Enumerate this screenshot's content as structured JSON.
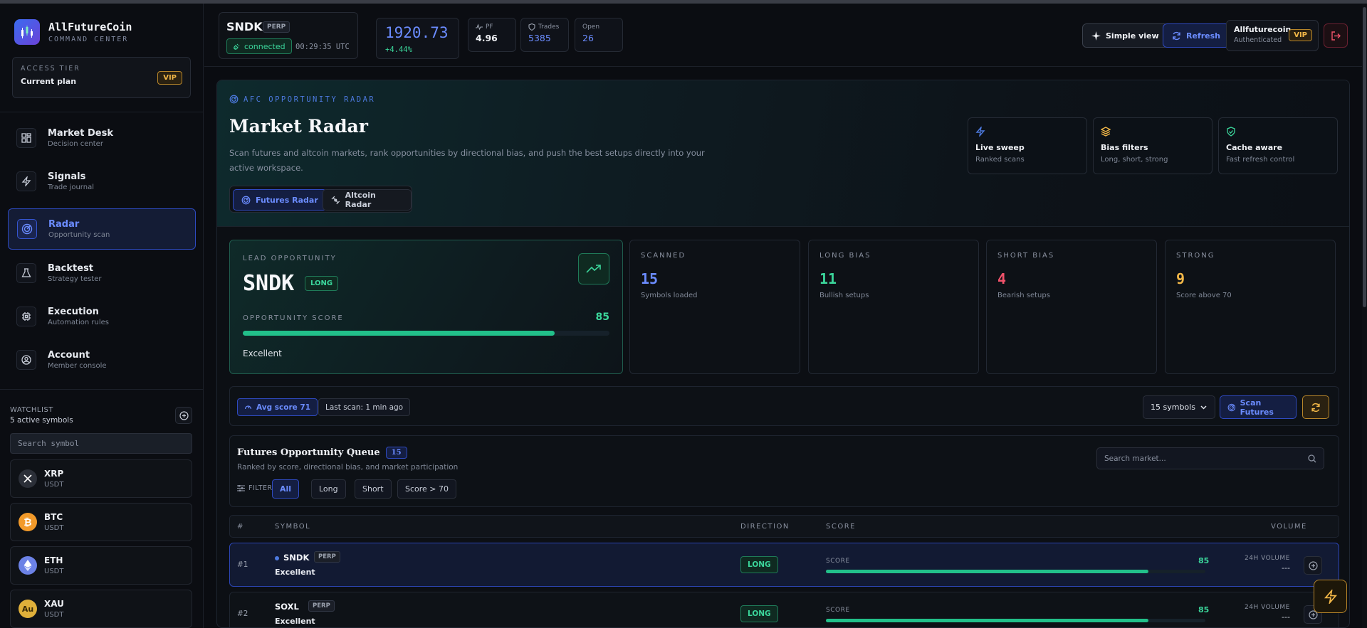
{
  "brand": {
    "title": "AllFutureCoin",
    "subtitle": "COMMAND CENTER"
  },
  "tier": {
    "label": "ACCESS TIER",
    "value": "Current plan",
    "badge": "VIP"
  },
  "nav": [
    {
      "label": "Market Desk",
      "sub": "Decision center",
      "icon": "grid-icon"
    },
    {
      "label": "Signals",
      "sub": "Trade journal",
      "icon": "lightning-icon"
    },
    {
      "label": "Radar",
      "sub": "Opportunity scan",
      "icon": "radar-icon",
      "active": true
    },
    {
      "label": "Backtest",
      "sub": "Strategy tester",
      "icon": "flask-icon"
    },
    {
      "label": "Execution",
      "sub": "Automation rules",
      "icon": "cpu-icon"
    },
    {
      "label": "Account",
      "sub": "Member console",
      "icon": "user-icon"
    }
  ],
  "watchlist": {
    "title": "WATCHLIST",
    "count": "5 active symbols",
    "search_placeholder": "Search symbol",
    "items": [
      {
        "symbol": "XRP",
        "quote": "USDT",
        "icon": "xrp-icon",
        "color": "#2b2f38"
      },
      {
        "symbol": "BTC",
        "quote": "USDT",
        "icon": "btc-icon",
        "color": "#f29a2a"
      },
      {
        "symbol": "ETH",
        "quote": "USDT",
        "icon": "eth-icon",
        "color": "#6c82e6"
      },
      {
        "symbol": "XAU",
        "quote": "USDT",
        "icon": "gold-icon",
        "color": "#e0b03a",
        "glyph": "Au"
      }
    ]
  },
  "header": {
    "symbol": "SNDK",
    "market": "PERP",
    "status": "connected",
    "clock": "00:29:35 UTC",
    "price": "1920.73",
    "change": "+4.44%",
    "stats": [
      {
        "label": "PF",
        "value": "4.96",
        "color": "#eef0f4",
        "icon": "pulse-icon"
      },
      {
        "label": "Trades",
        "value": "5385",
        "color": "#6b8cff",
        "icon": "shield-icon"
      },
      {
        "label": "Open",
        "value": "26",
        "color": "#6b8cff",
        "icon": ""
      }
    ],
    "simple_view": "Simple view",
    "refresh": "Refresh",
    "user_name": "Allfuturecoin",
    "user_status": "Authenticated",
    "user_badge": "VIP"
  },
  "hero": {
    "eyebrow": "AFC OPPORTUNITY RADAR",
    "title": "Market Radar",
    "description": "Scan futures and altcoin markets, rank opportunities by directional bias, and push the best setups directly into your active workspace.",
    "tabs": [
      "Futures Radar",
      "Altcoin Radar"
    ],
    "features": [
      {
        "title": "Live sweep",
        "sub": "Ranked scans",
        "icon": "lightning-icon",
        "color": "#4d7ae0"
      },
      {
        "title": "Bias filters",
        "sub": "Long, short, strong",
        "icon": "layers-icon",
        "color": "#f3b848"
      },
      {
        "title": "Cache aware",
        "sub": "Fast refresh control",
        "icon": "shield-check-icon",
        "color": "#3bd69b"
      }
    ]
  },
  "lead": {
    "label": "LEAD OPPORTUNITY",
    "symbol": "SNDK",
    "direction": "LONG",
    "score_label": "OPPORTUNITY SCORE",
    "score": "85",
    "score_pct": 85,
    "quality": "Excellent"
  },
  "kpis": [
    {
      "label": "SCANNED",
      "value": "15",
      "sub": "Symbols loaded",
      "color": "#6b8cff"
    },
    {
      "label": "LONG BIAS",
      "value": "11",
      "sub": "Bullish setups",
      "color": "#3bd69b"
    },
    {
      "label": "SHORT BIAS",
      "value": "4",
      "sub": "Bearish setups",
      "color": "#f0526a"
    },
    {
      "label": "STRONG",
      "value": "9",
      "sub": "Score above 70",
      "color": "#f3b848"
    }
  ],
  "toolbar": {
    "avg_score": "Avg score 71",
    "last_scan": "Last scan: 1 min ago",
    "symbols_select": "15 symbols",
    "scan_button": "Scan Futures"
  },
  "queue": {
    "title": "Futures Opportunity Queue",
    "count": "15",
    "sub": "Ranked by score, directional bias, and market participation",
    "search_placeholder": "Search market...",
    "filters_label": "FILTERS",
    "filters": [
      "All",
      "Long",
      "Short",
      "Score > 70"
    ]
  },
  "table": {
    "headers": [
      "#",
      "SYMBOL",
      "DIRECTION",
      "SCORE",
      "VOLUME"
    ],
    "score_label": "SCORE",
    "volume_label": "24H VOLUME",
    "rows": [
      {
        "rank": "#1",
        "symbol": "SNDK",
        "market": "PERP",
        "quality": "Excellent",
        "direction": "LONG",
        "score": "85",
        "score_pct": 85,
        "volume": "---"
      },
      {
        "rank": "#2",
        "symbol": "SOXL",
        "market": "PERP",
        "quality": "Excellent",
        "direction": "LONG",
        "score": "85",
        "score_pct": 85,
        "volume": "---"
      }
    ]
  }
}
